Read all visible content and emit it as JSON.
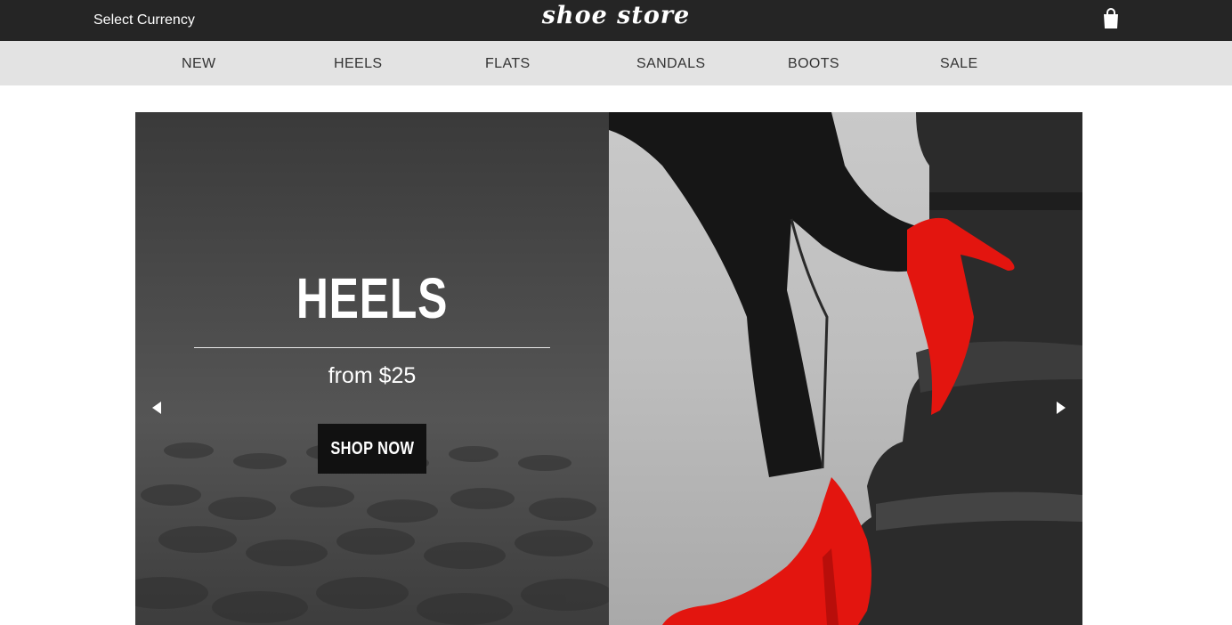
{
  "header": {
    "currency_label": "Select Currency",
    "logo_text": "shoe store",
    "cart_icon": "shopping-bag-icon"
  },
  "nav": {
    "items": [
      {
        "label": "NEW"
      },
      {
        "label": "HEELS"
      },
      {
        "label": "FLATS"
      },
      {
        "label": "SANDALS"
      },
      {
        "label": "BOOTS"
      },
      {
        "label": "SALE"
      }
    ]
  },
  "hero": {
    "title": "HEELS",
    "subtitle": "from $25",
    "cta_label": "SHOP NOW",
    "prev_icon": "triangle-left-icon",
    "next_icon": "triangle-right-icon"
  },
  "colors": {
    "topbar_bg": "#252525",
    "navbar_bg": "#e3e3e3",
    "button_bg": "#111111",
    "shoe_red": "#e3150f"
  }
}
